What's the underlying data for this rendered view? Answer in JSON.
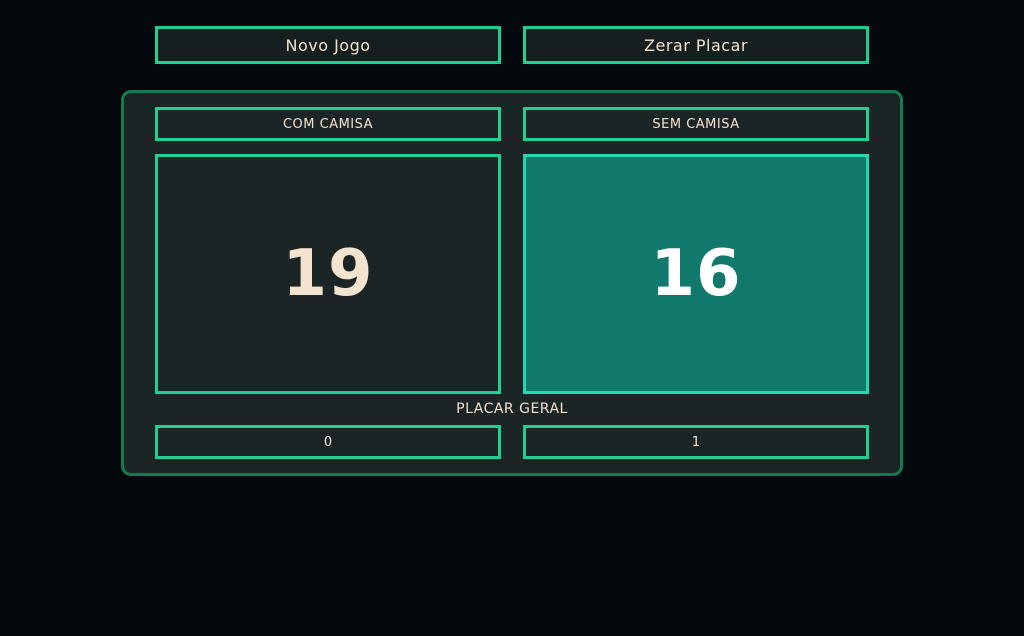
{
  "toolbar": {
    "new_game_label": "Novo Jogo",
    "reset_score_label": "Zerar Placar"
  },
  "teams": {
    "left": {
      "label": "COM CAMISA",
      "score": "19",
      "overall": "0"
    },
    "right": {
      "label": "SEM CAMISA",
      "score": "16",
      "overall": "1"
    }
  },
  "overall_title": "PLACAR GERAL",
  "colors": {
    "background": "#03090c",
    "panel": "#1c2525",
    "accent_border": "#1ed190",
    "highlight_score": "#10796b",
    "text": "#f4e3cf"
  }
}
